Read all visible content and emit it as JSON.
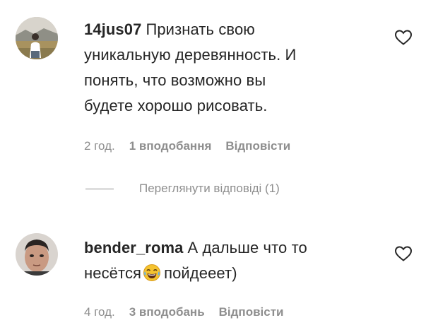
{
  "comments": [
    {
      "username": "14jus07",
      "text_lines": [
        "Признать свою",
        "уникальную деревянность. И",
        "понять, что возможно вы",
        "будете хорошо рисовать."
      ],
      "time": "2 год.",
      "likes": "1 вподобання",
      "reply": "Відповісти",
      "avatar_icon": "user-avatar-landscape",
      "heart_icon": "heart-outline-icon"
    },
    {
      "username": "bender_roma",
      "text_line1": "А дальше что то",
      "text_line2_before": "несётся",
      "text_line2_after": "пойдееет)",
      "emoji": "tears-of-joy-emoji",
      "time": "4 год.",
      "likes": "3 вподобань",
      "reply": "Відповісти",
      "avatar_icon": "user-avatar-face",
      "heart_icon": "heart-outline-icon"
    }
  ],
  "view_replies": "Переглянути відповіді (1)",
  "colors": {
    "text": "#262626",
    "secondary": "#8e8e8e",
    "background": "#ffffff"
  }
}
